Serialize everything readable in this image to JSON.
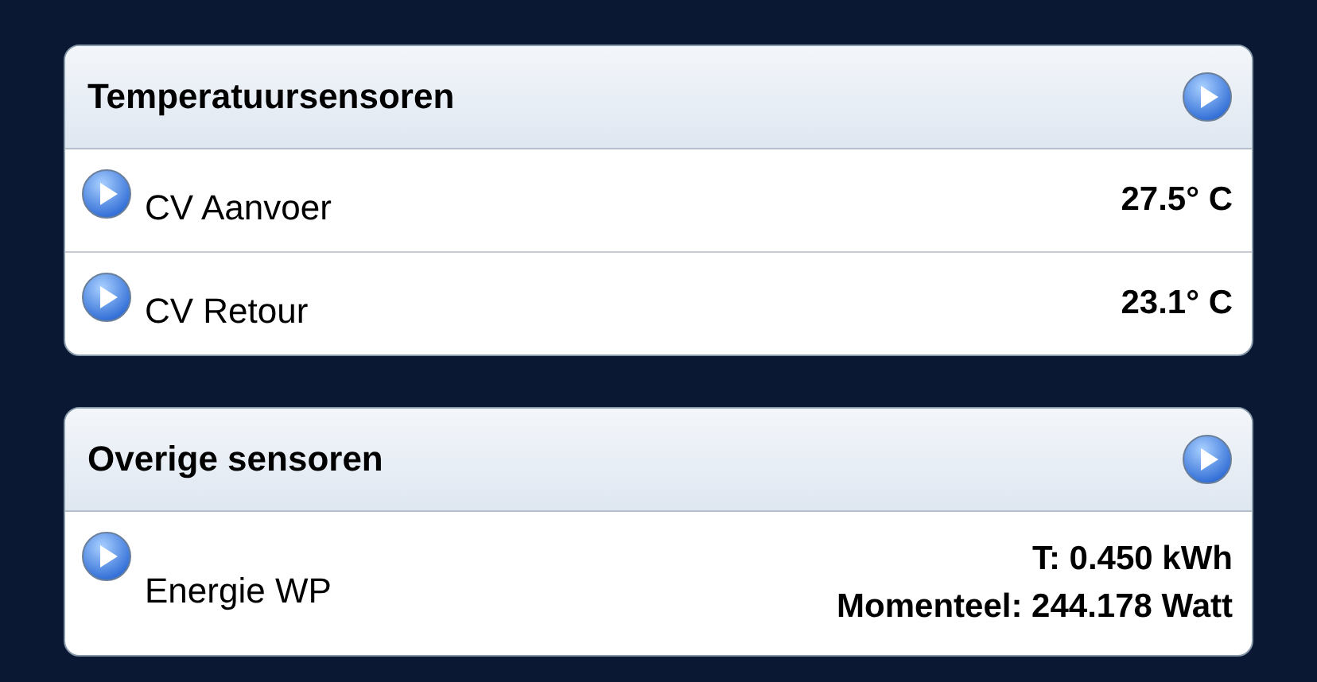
{
  "panels": [
    {
      "title": "Temperatuursensoren",
      "rows": [
        {
          "name": "CV Aanvoer",
          "values": [
            "27.5° C"
          ]
        },
        {
          "name": "CV Retour",
          "values": [
            "23.1° C"
          ]
        }
      ]
    },
    {
      "title": "Overige sensoren",
      "rows": [
        {
          "name": "Energie WP",
          "values": [
            "T: 0.450 kWh",
            "Momenteel: 244.178 Watt"
          ]
        }
      ]
    }
  ]
}
